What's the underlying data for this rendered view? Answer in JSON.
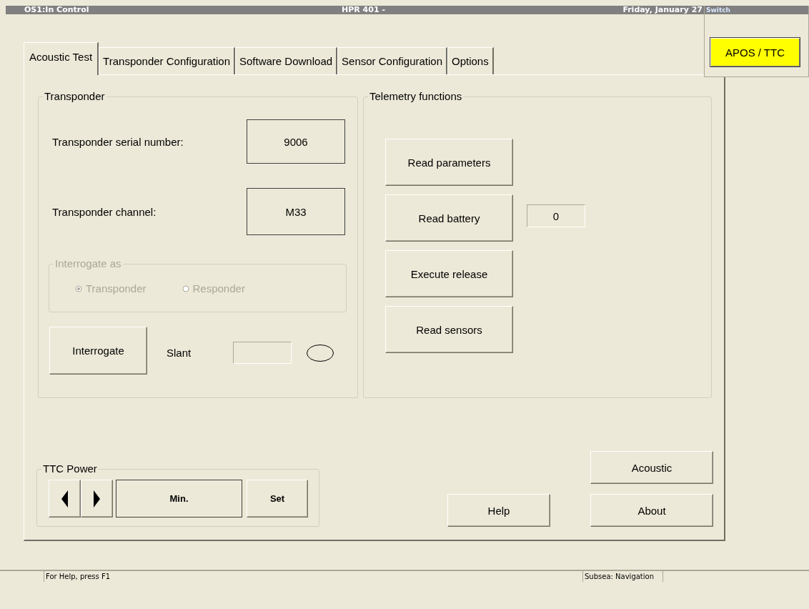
{
  "title_bar": {
    "left": "OS1:In Control",
    "center": "HPR 401 -",
    "right": "Friday, January 27"
  },
  "switch_panel": {
    "title": "Switch",
    "button": "APOS / TTC"
  },
  "tabs": [
    {
      "label": "Acoustic Test",
      "selected": true
    },
    {
      "label": "Transponder Configuration",
      "selected": false
    },
    {
      "label": "Software Download",
      "selected": false
    },
    {
      "label": "Sensor Configuration",
      "selected": false
    },
    {
      "label": "Options",
      "selected": false
    }
  ],
  "transponder": {
    "title": "Transponder",
    "fields": [
      {
        "label": "Transponder serial number:",
        "value": "9006"
      },
      {
        "label": "Transponder channel:",
        "value": "M33"
      }
    ],
    "interrogate_as": {
      "title": "Interrogate as",
      "disabled": true,
      "options": [
        {
          "label": "Transponder",
          "selected": true
        },
        {
          "label": "Responder",
          "selected": false
        }
      ]
    },
    "interrogate_button": "Interrogate",
    "slant_label": "Slant"
  },
  "telemetry": {
    "title": "Telemetry functions",
    "buttons": [
      {
        "label": "Read parameters"
      },
      {
        "label": "Read battery",
        "reading": "0"
      },
      {
        "label": "Execute release"
      },
      {
        "label": "Read sensors"
      }
    ]
  },
  "ttc_power": {
    "title": "TTC Power",
    "value": "Min.",
    "set_button": "Set"
  },
  "buttons": [
    {
      "kind": "help",
      "label": "Help"
    },
    {
      "kind": "acoustic",
      "label": "Acoustic"
    },
    {
      "kind": "about",
      "label": "About"
    }
  ],
  "status_bar": [
    "For Help, press F1",
    "Subsea: Navigation"
  ]
}
